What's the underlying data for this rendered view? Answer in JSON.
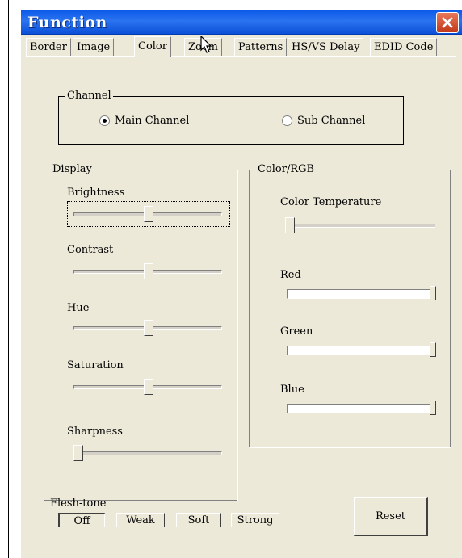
{
  "window": {
    "title": "Function"
  },
  "tabs": [
    {
      "label": "Border"
    },
    {
      "label": "Image"
    },
    {
      "label": "Color",
      "active": true
    },
    {
      "label": "Zoom"
    },
    {
      "label": "Patterns"
    },
    {
      "label": "HS/VS Delay"
    },
    {
      "label": "EDID Code"
    }
  ],
  "channel": {
    "legend": "Channel",
    "options": [
      {
        "label": "Main Channel",
        "selected": true
      },
      {
        "label": "Sub Channel",
        "selected": false
      }
    ]
  },
  "display": {
    "legend": "Display",
    "sliders": [
      {
        "label": "Brightness",
        "value_fraction": 0.5,
        "focused": true
      },
      {
        "label": "Contrast",
        "value_fraction": 0.5
      },
      {
        "label": "Hue",
        "value_fraction": 0.5
      },
      {
        "label": "Saturation",
        "value_fraction": 0.5
      },
      {
        "label": "Sharpness",
        "value_fraction": 0.0
      }
    ]
  },
  "color_rgb": {
    "legend": "Color/RGB",
    "color_temperature": {
      "label": "Color Temperature",
      "value_fraction": 0.0
    },
    "channels": [
      {
        "label": "Red",
        "value_fraction": 1.0
      },
      {
        "label": "Green",
        "value_fraction": 1.0
      },
      {
        "label": "Blue",
        "value_fraction": 1.0
      }
    ]
  },
  "flesh_tone": {
    "label": "Flesh-tone",
    "options": [
      {
        "label": "Off",
        "pressed": true
      },
      {
        "label": "Weak"
      },
      {
        "label": "Soft"
      },
      {
        "label": "Strong"
      }
    ]
  },
  "reset_label": "Reset",
  "icons": {
    "close": "close-icon",
    "cursor": "mouse-pointer-icon",
    "radio": "radio-icon"
  },
  "colors": {
    "titlebar": "#0a58e8",
    "close": "#d4502d",
    "dialog": "#ece9d8"
  }
}
